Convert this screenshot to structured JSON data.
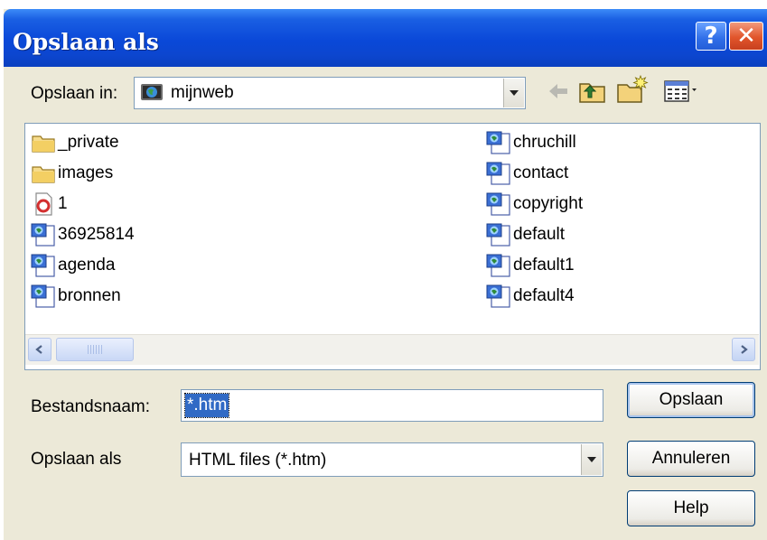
{
  "dialog": {
    "title": "Opslaan als",
    "help_glyph": "?",
    "close_glyph": "✕"
  },
  "save_in": {
    "label": "Opslaan in:",
    "value": "mijnweb"
  },
  "toolbar": {
    "icons": [
      "back-arrow-icon",
      "up-folder-icon",
      "new-folder-icon",
      "view-menu-icon"
    ]
  },
  "files": {
    "left_column": [
      {
        "name": "_private",
        "icon": "folder-icon"
      },
      {
        "name": "images",
        "icon": "folder-icon"
      },
      {
        "name": "1",
        "icon": "opera-file-icon"
      },
      {
        "name": "36925814",
        "icon": "web-page-icon"
      },
      {
        "name": "agenda",
        "icon": "web-page-icon"
      },
      {
        "name": "bronnen",
        "icon": "web-page-icon"
      }
    ],
    "right_column": [
      {
        "name": "chruchill",
        "icon": "web-page-icon"
      },
      {
        "name": "contact",
        "icon": "web-page-icon"
      },
      {
        "name": "copyright",
        "icon": "web-page-icon"
      },
      {
        "name": "default",
        "icon": "web-page-icon"
      },
      {
        "name": "default1",
        "icon": "web-page-icon"
      },
      {
        "name": "default4",
        "icon": "web-page-icon"
      }
    ]
  },
  "filename": {
    "label": "Bestandsnaam:",
    "value": "*.htm"
  },
  "filetype": {
    "label": "Opslaan als",
    "value": "HTML files (*.htm)"
  },
  "buttons": {
    "save": "Opslaan",
    "cancel": "Annuleren",
    "help": "Help"
  },
  "colors": {
    "title_bar": "#0a48d8",
    "selection": "#316ac5",
    "dialog_face": "#ece9d8"
  }
}
